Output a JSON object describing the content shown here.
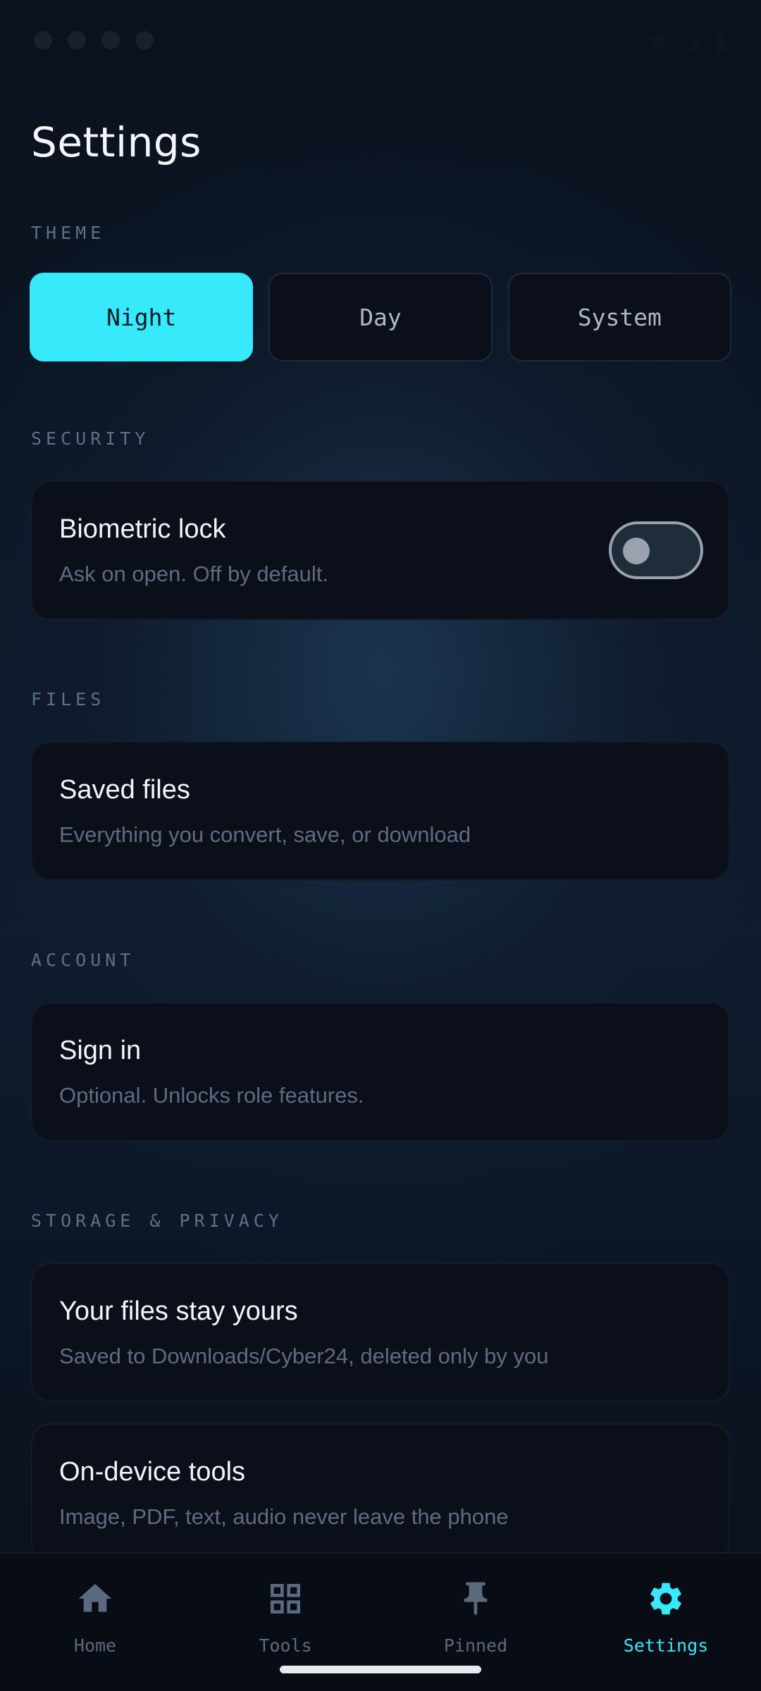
{
  "page": {
    "title": "Settings"
  },
  "theme": {
    "label": "THEME",
    "options": [
      "Night",
      "Day",
      "System"
    ],
    "selected": "Night"
  },
  "security": {
    "label": "SECURITY",
    "biometric": {
      "title": "Biometric lock",
      "subtitle": "Ask on open. Off by default.",
      "enabled": false
    }
  },
  "files": {
    "label": "FILES",
    "saved": {
      "title": "Saved files",
      "subtitle": "Everything you convert, save, or download"
    }
  },
  "account": {
    "label": "ACCOUNT",
    "signin": {
      "title": "Sign in",
      "subtitle": "Optional. Unlocks role features."
    }
  },
  "storage": {
    "label": "STORAGE & PRIVACY",
    "items": [
      {
        "title": "Your files stay yours",
        "subtitle": "Saved to Downloads/Cyber24, deleted only by you"
      },
      {
        "title": "On-device tools",
        "subtitle": "Image, PDF, text, audio never leave the phone"
      }
    ]
  },
  "nav": {
    "items": [
      {
        "label": "Home",
        "icon": "home-icon"
      },
      {
        "label": "Tools",
        "icon": "grid-icon"
      },
      {
        "label": "Pinned",
        "icon": "pin-icon"
      },
      {
        "label": "Settings",
        "icon": "gear-icon"
      }
    ],
    "active": "Settings"
  },
  "colors": {
    "accent": "#36e9fb",
    "background": "#0a0f1a",
    "muted": "#5e6c80"
  }
}
